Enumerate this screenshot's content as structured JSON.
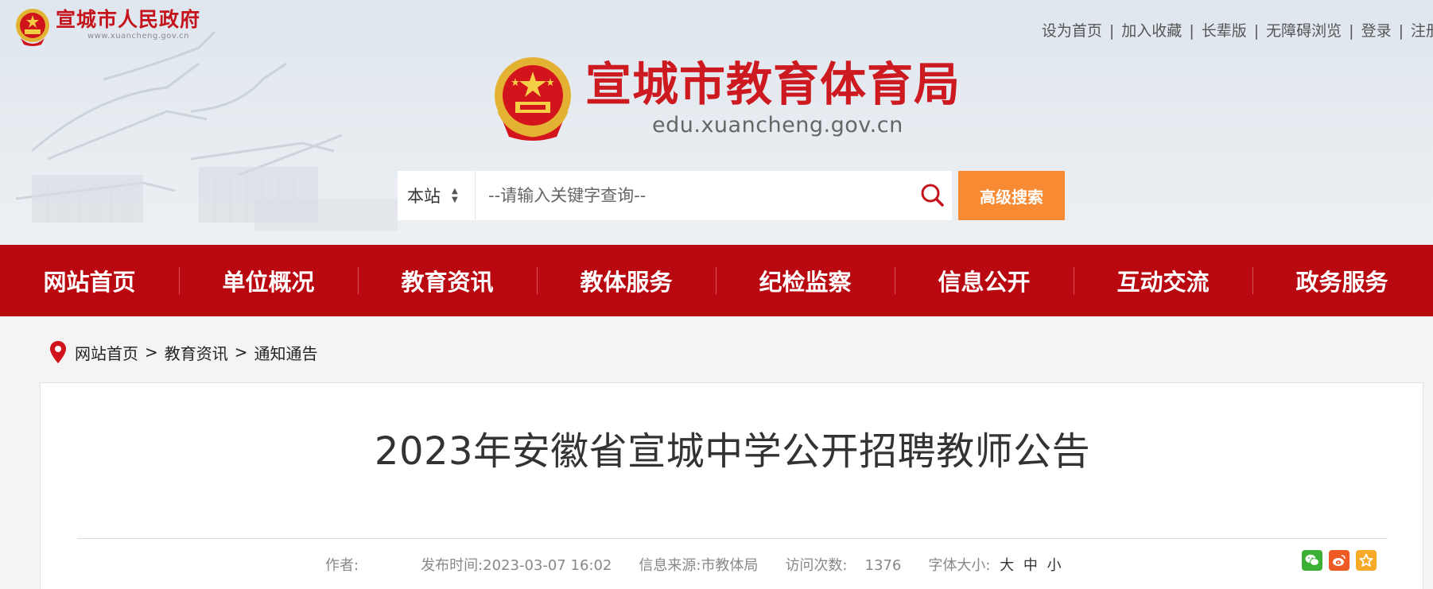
{
  "gov": {
    "name": "宣城市人民政府",
    "domain": "www.xuancheng.gov.cn"
  },
  "toplinks": [
    "设为首页",
    "加入收藏",
    "长辈版",
    "无障碍浏览",
    "登录",
    "注册"
  ],
  "site": {
    "title": "宣城市教育体育局",
    "domain": "edu.xuancheng.gov.cn"
  },
  "search": {
    "scope": "本站",
    "placeholder": "--请输入关键字查询--",
    "advanced_label": "高级搜索"
  },
  "nav": [
    "网站首页",
    "单位概况",
    "教育资讯",
    "教体服务",
    "纪检监察",
    "信息公开",
    "互动交流",
    "政务服务"
  ],
  "breadcrumb": [
    "网站首页",
    "教育资讯",
    "通知通告"
  ],
  "breadcrumb_sep": ">",
  "article": {
    "title": "2023年安徽省宣城中学公开招聘教师公告",
    "author_label": "作者:",
    "author_value": "",
    "published_label": "发布时间:",
    "published_value": "2023-03-07 16:02",
    "source_label": "信息来源:",
    "source_value": "市教体局",
    "visits_label": "访问次数:",
    "visits_value": "1376",
    "fontsize_label": "字体大小:",
    "fontsize_options": [
      "大",
      "中",
      "小"
    ]
  },
  "share_icons": [
    "wechat-icon",
    "weibo-icon",
    "favorite-icon"
  ],
  "colors": {
    "brand_red": "#c4131b",
    "nav_red": "#b9080f",
    "search_orange": "#f78a32"
  }
}
